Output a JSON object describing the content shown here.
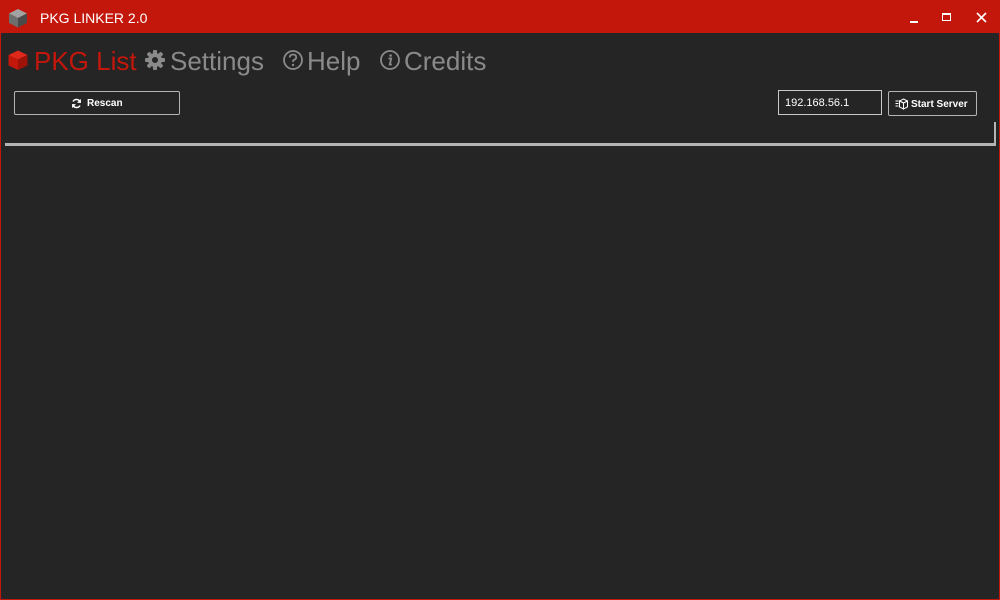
{
  "window": {
    "title": "PKG LINKER 2.0",
    "accent_color": "#c4170c",
    "background_color": "#252525",
    "icons": {
      "app": "package-cube-icon",
      "minimize": "minimize-icon",
      "maximize": "maximize-icon",
      "close": "close-icon"
    }
  },
  "nav": {
    "tabs": [
      {
        "label": "PKG List",
        "icon": "package-cube-icon",
        "active": true
      },
      {
        "label": "Settings",
        "icon": "gear-icon",
        "active": false
      },
      {
        "label": "Help",
        "icon": "question-circle-icon",
        "active": false
      },
      {
        "label": "Credits",
        "icon": "info-circle-icon",
        "active": false
      }
    ]
  },
  "toolbar": {
    "rescan_label": "Rescan",
    "rescan_icon": "refresh-icon",
    "ip_value": "192.168.56.1",
    "start_server_label": "Start Server",
    "start_server_icon": "server-start-icon"
  },
  "pkg_list": {
    "items": []
  }
}
